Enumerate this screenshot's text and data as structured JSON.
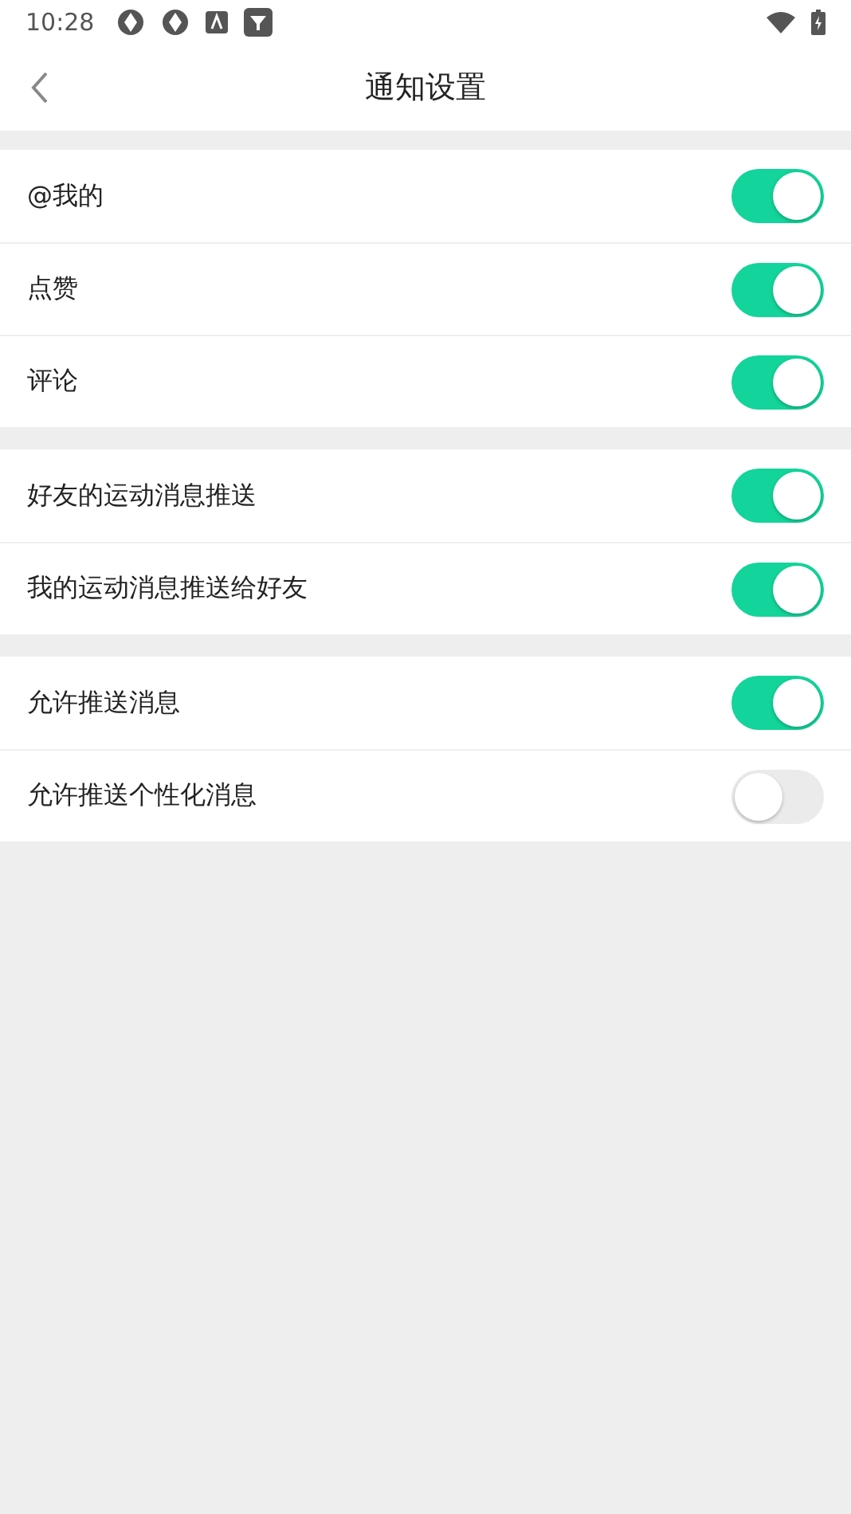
{
  "status_bar": {
    "time": "10:28"
  },
  "header": {
    "title": "通知设置"
  },
  "groups": [
    {
      "items": [
        {
          "label": "@我的",
          "on": true
        },
        {
          "label": "点赞",
          "on": true
        },
        {
          "label": "评论",
          "on": true
        }
      ]
    },
    {
      "items": [
        {
          "label": "好友的运动消息推送",
          "on": true
        },
        {
          "label": "我的运动消息推送给好友",
          "on": true
        }
      ]
    },
    {
      "items": [
        {
          "label": "允许推送消息",
          "on": true
        },
        {
          "label": "允许推送个性化消息",
          "on": false
        }
      ]
    }
  ]
}
